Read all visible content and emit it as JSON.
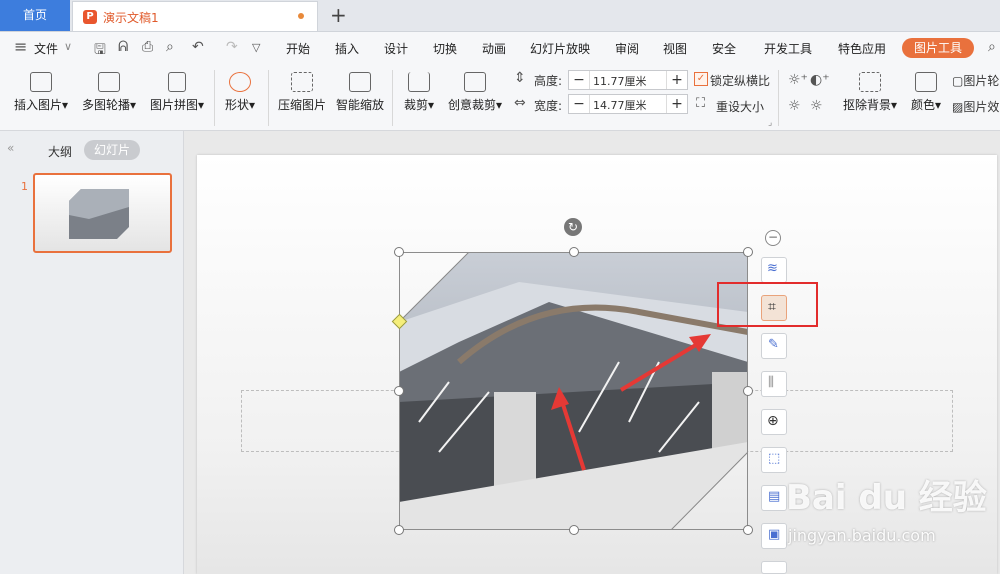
{
  "tabs": {
    "home": "首页",
    "document": "演示文稿1"
  },
  "menubar": {
    "file": "文件",
    "items": [
      "开始",
      "插入",
      "设计",
      "切换",
      "动画",
      "幻灯片放映",
      "审阅",
      "视图",
      "安全",
      "开发工具",
      "特色应用"
    ],
    "active_context": "图片工具"
  },
  "ribbon": {
    "insert_picture": "插入图片",
    "multi_carousel": "多图轮播",
    "picture_collage": "图片拼图",
    "shape": "形状",
    "compress_picture": "压缩图片",
    "smart_zoom": "智能缩放",
    "crop": "裁剪",
    "creative_crop": "创意裁剪",
    "height_label": "高度:",
    "height_value": "11.77厘米",
    "width_label": "宽度:",
    "width_value": "14.77厘米",
    "lock_ratio": "锁定纵横比",
    "reset_size": "重设大小",
    "remove_bg": "抠除背景",
    "color": "颜色",
    "picture_right_1": "图片轮",
    "picture_right_2": "图片效"
  },
  "sidebar": {
    "outline": "大纲",
    "slides": "幻灯片",
    "slide_number": "1"
  },
  "watermark": {
    "main": "Bai du 经验",
    "sub": "jingyan.baidu.com"
  },
  "colors": {
    "accent": "#e9713d",
    "home_tab": "#3d7ddd",
    "highlight": "#e22c2c"
  }
}
